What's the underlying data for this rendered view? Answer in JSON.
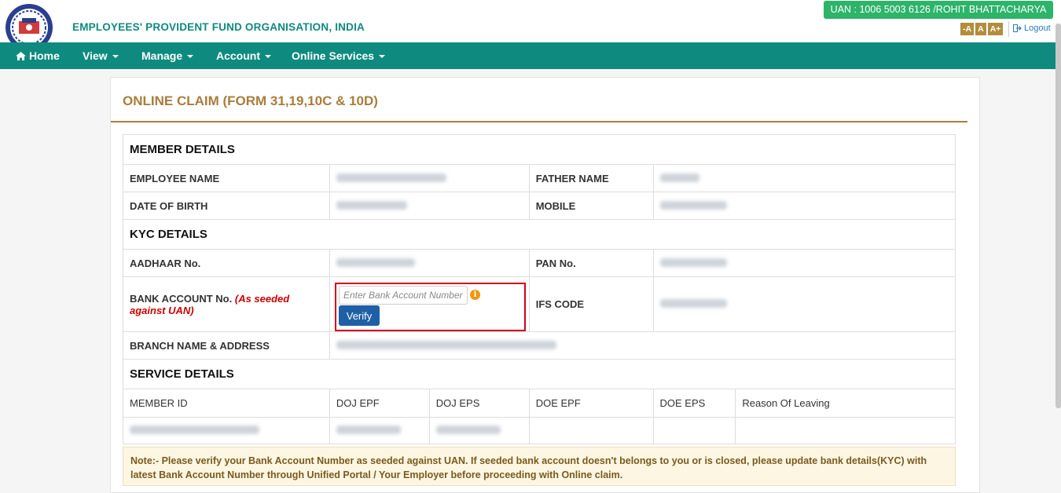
{
  "header": {
    "org_title": "EMPLOYEES' PROVIDENT FUND ORGANISATION, INDIA",
    "uan_badge": "UAN : 1006 5003 6126 /ROHIT BHATTACHARYA",
    "font_controls": [
      "-A",
      "A",
      "A+"
    ],
    "logout_label": "Logout",
    "logout_icon": "sign-out-icon",
    "brand_color": "#0f8a7e"
  },
  "nav": {
    "home_label": "Home",
    "home_icon": "home-icon",
    "view_label": "View",
    "manage_label": "Manage",
    "account_label": "Account",
    "online_services_label": "Online Services"
  },
  "page": {
    "title": "ONLINE CLAIM (FORM 31,19,10C & 10D)"
  },
  "member_details": {
    "heading": "MEMBER DETAILS",
    "employee_name_label": "EMPLOYEE NAME",
    "father_name_label": "FATHER NAME",
    "dob_label": "DATE OF BIRTH",
    "mobile_label": "MOBILE"
  },
  "kyc_details": {
    "heading": "KYC DETAILS",
    "aadhaar_label": "AADHAAR No.",
    "pan_label": "PAN No.",
    "bank_account_label": "BANK ACCOUNT No.",
    "bank_account_note": "(As seeded against UAN)",
    "bank_account_placeholder": "Enter Bank Account Number",
    "verify_label": "Verify",
    "ifsc_label": "IFS CODE",
    "branch_label": "BRANCH NAME & ADDRESS"
  },
  "service_details": {
    "heading": "SERVICE DETAILS",
    "columns": [
      "MEMBER ID",
      "DOJ EPF",
      "DOJ EPS",
      "DOE EPF",
      "DOE EPS",
      "Reason Of Leaving"
    ]
  },
  "note": {
    "text": "Note:- Please verify your Bank Account Number as seeded against UAN. If seeded bank account doesn't belongs to you or is closed, please update bank details(KYC) with latest Bank Account Number through Unified Portal / Your Employer before proceeding with Online claim."
  }
}
